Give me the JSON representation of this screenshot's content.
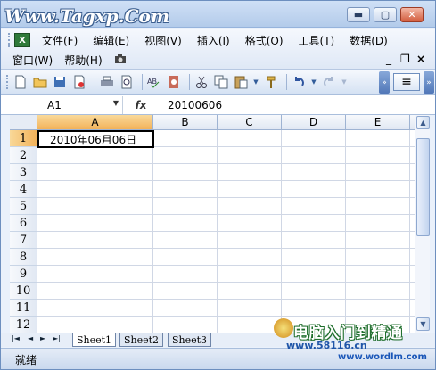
{
  "window": {
    "watermark_text": "Www.Tagxp.Com",
    "controls": {
      "minimize": "▬",
      "maximize": "▢",
      "close": "✕"
    }
  },
  "menu": {
    "app_icon": "X",
    "row1": [
      "文件(F)",
      "编辑(E)",
      "视图(V)",
      "插入(I)",
      "格式(O)",
      "工具(T)",
      "数据(D)"
    ],
    "row2": [
      "窗口(W)",
      "帮助(H)"
    ],
    "row2_icon": "camera-icon",
    "doc_controls": {
      "minimize": "_",
      "restore": "❐",
      "close": "×"
    }
  },
  "toolbar": {
    "icons": [
      "new-icon",
      "open-icon",
      "save-icon",
      "permission-icon",
      "print-icon",
      "print-preview-icon",
      "spelling-icon",
      "research-icon",
      "cut-icon",
      "copy-icon",
      "paste-icon",
      "format-painter-icon",
      "undo-icon",
      "redo-icon"
    ]
  },
  "formula_bar": {
    "name_box": "A1",
    "fx_label": "fx",
    "value": "20100606"
  },
  "grid": {
    "columns": [
      "A",
      "B",
      "C",
      "D",
      "E"
    ],
    "active_column": "A",
    "rows": [
      "1",
      "2",
      "3",
      "4",
      "5",
      "6",
      "7",
      "8",
      "9",
      "10",
      "11",
      "12"
    ],
    "active_row": "1",
    "cells": {
      "A1": "2010年06月06日"
    }
  },
  "sheets": {
    "nav": [
      "|◄",
      "◄",
      "►",
      "►|"
    ],
    "tabs": [
      "Sheet1",
      "Sheet2",
      "Sheet3"
    ],
    "active": "Sheet1"
  },
  "status": {
    "text": "就绪"
  },
  "logo": {
    "text_cn": "电脑入门到精通",
    "url1": "www.58116.cn",
    "url2": "www.wordlm.com"
  },
  "colors": {
    "accent": "#f2b25a",
    "frame": "#6d8fbf"
  }
}
